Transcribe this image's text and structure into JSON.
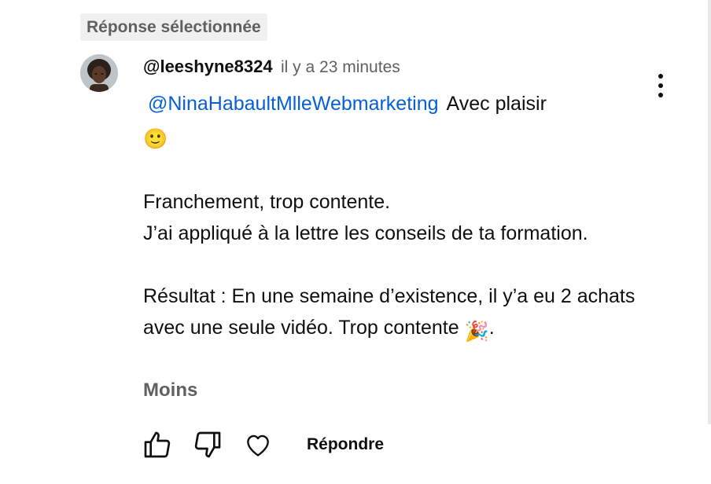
{
  "badge": {
    "label": "Réponse sélectionnée"
  },
  "comment": {
    "author": "@leeshyne8324",
    "time": "il y a 23 minutes",
    "mention": "@NinaHabaultMlleWebmarketing",
    "line1_text": "Avec plaisir",
    "smile_emoji": "🙂",
    "para2_line1": "Franchement, trop contente.",
    "para2_line2": "J’ai appliqué à la lettre les conseils de ta formation.",
    "para3": "Résultat : En une semaine d’existence, il y’a eu 2 achats avec une seule vidéo. Trop contente",
    "party_emoji": "🎉",
    "para3_end": ".",
    "less_label": "Moins"
  },
  "actions": {
    "like_icon": "thumbs-up-icon",
    "dislike_icon": "thumbs-down-icon",
    "heart_icon": "heart-icon",
    "reply_label": "Répondre"
  },
  "colors": {
    "mention": "#065fd4",
    "muted": "#606060",
    "text": "#0f0f0f",
    "badge_bg": "#f0f0f0"
  }
}
